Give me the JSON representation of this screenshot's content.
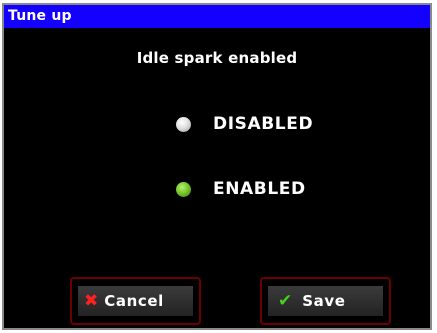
{
  "window": {
    "title": "Tune up"
  },
  "screen": {
    "subtitle": "Idle spark enabled"
  },
  "options": [
    {
      "label": "DISABLED",
      "selected": false
    },
    {
      "label": "ENABLED",
      "selected": true
    }
  ],
  "buttons": {
    "cancel": {
      "label": "Cancel",
      "icon": "x-icon"
    },
    "save": {
      "label": "Save",
      "icon": "check-icon"
    }
  },
  "colors": {
    "title_bar": "#1400ff",
    "background": "#000000",
    "selected_radio": "#78c82a",
    "unselected_radio": "#e0e0e0",
    "cancel_icon": "#ff2020",
    "save_icon": "#45d020",
    "button_border": "#6a0000"
  }
}
